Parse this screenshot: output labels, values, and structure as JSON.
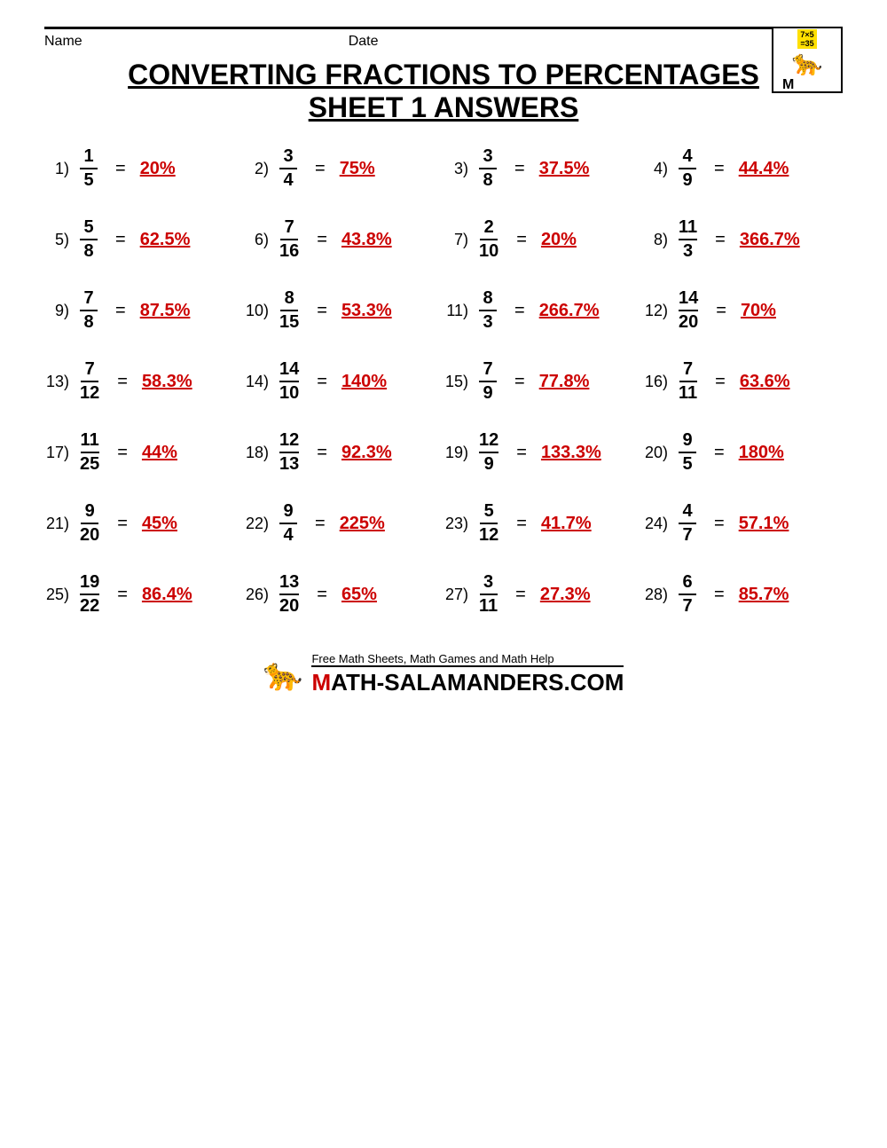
{
  "header": {
    "name_label": "Name",
    "date_label": "Date"
  },
  "title": {
    "line1": "CONVERTING FRACTIONS TO PERCENTAGES",
    "line2": "SHEET 1 ANSWERS"
  },
  "problems": [
    [
      {
        "num": "1)",
        "n": "1",
        "d": "5",
        "answer": "20%"
      },
      {
        "num": "2)",
        "n": "3",
        "d": "4",
        "answer": "75%"
      },
      {
        "num": "3)",
        "n": "3",
        "d": "8",
        "answer": "37.5%"
      },
      {
        "num": "4)",
        "n": "4",
        "d": "9",
        "answer": "44.4%"
      }
    ],
    [
      {
        "num": "5)",
        "n": "5",
        "d": "8",
        "answer": "62.5%"
      },
      {
        "num": "6)",
        "n": "7",
        "d": "16",
        "answer": "43.8%"
      },
      {
        "num": "7)",
        "n": "2",
        "d": "10",
        "answer": "20%"
      },
      {
        "num": "8)",
        "n": "11",
        "d": "3",
        "answer": "366.7%"
      }
    ],
    [
      {
        "num": "9)",
        "n": "7",
        "d": "8",
        "answer": "87.5%"
      },
      {
        "num": "10)",
        "n": "8",
        "d": "15",
        "answer": "53.3%"
      },
      {
        "num": "11)",
        "n": "8",
        "d": "3",
        "answer": "266.7%"
      },
      {
        "num": "12)",
        "n": "14",
        "d": "20",
        "answer": "70%"
      }
    ],
    [
      {
        "num": "13)",
        "n": "7",
        "d": "12",
        "answer": "58.3%"
      },
      {
        "num": "14)",
        "n": "14",
        "d": "10",
        "answer": "140%"
      },
      {
        "num": "15)",
        "n": "7",
        "d": "9",
        "answer": "77.8%"
      },
      {
        "num": "16)",
        "n": "7",
        "d": "11",
        "answer": "63.6%"
      }
    ],
    [
      {
        "num": "17)",
        "n": "11",
        "d": "25",
        "answer": "44%"
      },
      {
        "num": "18)",
        "n": "12",
        "d": "13",
        "answer": "92.3%"
      },
      {
        "num": "19)",
        "n": "12",
        "d": "9",
        "answer": "133.3%"
      },
      {
        "num": "20)",
        "n": "9",
        "d": "5",
        "answer": "180%"
      }
    ],
    [
      {
        "num": "21)",
        "n": "9",
        "d": "20",
        "answer": "45%"
      },
      {
        "num": "22)",
        "n": "9",
        "d": "4",
        "answer": "225%"
      },
      {
        "num": "23)",
        "n": "5",
        "d": "12",
        "answer": "41.7%"
      },
      {
        "num": "24)",
        "n": "4",
        "d": "7",
        "answer": "57.1%"
      }
    ],
    [
      {
        "num": "25)",
        "n": "19",
        "d": "22",
        "answer": "86.4%"
      },
      {
        "num": "26)",
        "n": "13",
        "d": "20",
        "answer": "65%"
      },
      {
        "num": "27)",
        "n": "3",
        "d": "11",
        "answer": "27.3%"
      },
      {
        "num": "28)",
        "n": "6",
        "d": "7",
        "answer": "85.7%"
      }
    ]
  ],
  "footer": {
    "tagline": "Free Math Sheets, Math Games and Math Help",
    "site": "ATH-SALAMANDERS.COM"
  }
}
